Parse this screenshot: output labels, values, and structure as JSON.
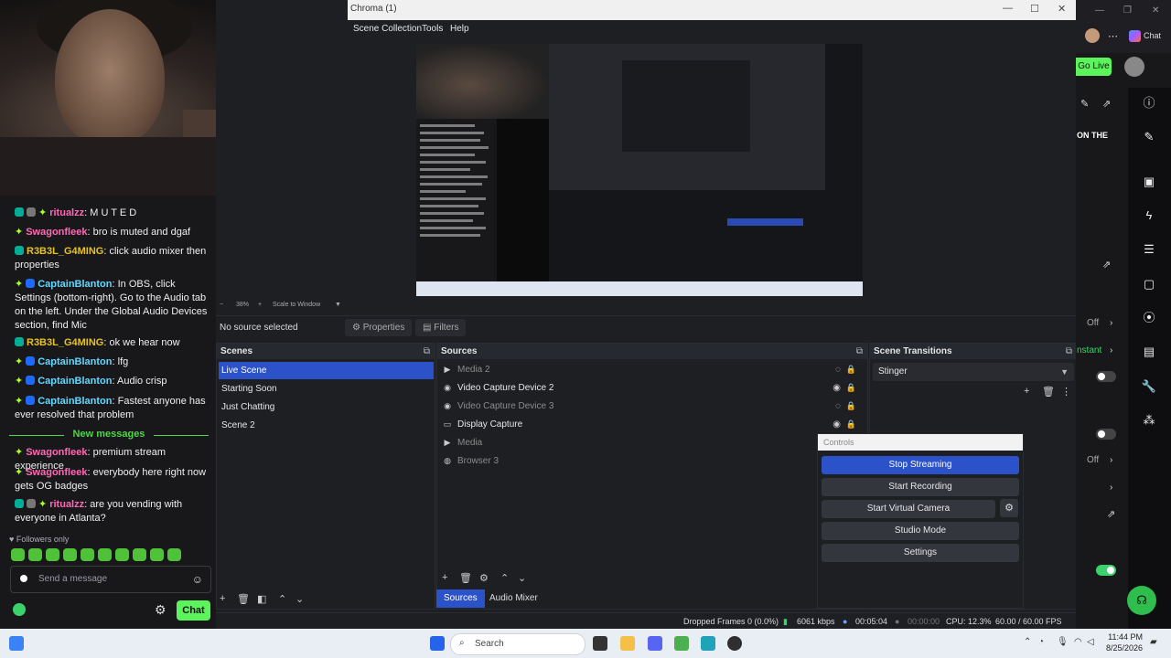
{
  "obs": {
    "window_title": "Chroma (1)",
    "menu": [
      "Scene Collection",
      "Tools",
      "Help"
    ],
    "zoom": [
      "38%",
      "Scale to Window"
    ],
    "no_source": "No source selected",
    "properties_label": "Properties",
    "filters_label": "Filters",
    "scenes": {
      "title": "Scenes",
      "items": [
        "Live Scene",
        "Starting Soon",
        "Just Chatting",
        "Scene 2"
      ]
    },
    "sources": {
      "title": "Sources",
      "items": [
        "Media 2",
        "Video Capture Device 2",
        "Video Capture Device 3",
        "Display Capture",
        "Media",
        "Browser 3"
      ]
    },
    "transitions": {
      "title": "Scene Transitions",
      "selected": "Stinger"
    },
    "controls": {
      "title": "Controls",
      "buttons": [
        "Stop Streaming",
        "Start Recording",
        "Start Virtual Camera",
        "Studio Mode",
        "Settings"
      ]
    },
    "tabs": [
      "Sources",
      "Audio Mixer"
    ],
    "status": {
      "dropped": "Dropped Frames 0 (0.0%)",
      "bitrate": "6061 kbps",
      "stream_time": "00:05:04",
      "rec_time": "00:00:00",
      "cpu": "CPU: 12.3%",
      "fps": "60.00 / 60.00 FPS"
    }
  },
  "chat": {
    "messages": [
      {
        "user": "ritualzz",
        "sep": ": ",
        "text": "M U T E D"
      },
      {
        "user": "Swagonfleek",
        "sep": ": ",
        "text": "bro is muted and dgaf"
      },
      {
        "user": "R3B3L_G4MING",
        "sep": ": ",
        "text": "click audio mixer then properties"
      },
      {
        "user": "CaptainBlanton",
        "sep": ": ",
        "text": "In OBS, click Settings (bottom-right). Go to the Audio tab on the left. Under the Global Audio Devices section, find Mic"
      },
      {
        "user": "R3B3L_G4MING",
        "sep": ": ",
        "text": "ok we hear now"
      },
      {
        "user": "CaptainBlanton",
        "sep": ": ",
        "text": "lfg"
      },
      {
        "user": "CaptainBlanton",
        "sep": ": ",
        "text": "Audio crisp"
      },
      {
        "user": "CaptainBlanton",
        "sep": ": ",
        "text": "Fastest anyone has ever resolved that problem"
      },
      {
        "user": "Swagonfleek",
        "sep": ": ",
        "text": "premium stream experience"
      },
      {
        "user": "Swagonfleek",
        "sep": ": ",
        "text": "everybody here right now gets OG badges"
      },
      {
        "user": "ritualzz",
        "sep": ": ",
        "text": "are you vending with everyone in Atlanta?"
      }
    ],
    "new_messages": "New messages",
    "followers_only": "Followers only",
    "placeholder": "Send a message",
    "send_label": "Chat"
  },
  "twitch": {
    "chat_label": "Chat",
    "go_live": "Go Live",
    "on_the": "ON THE",
    "off1": "Off",
    "instant": "nstant",
    "off2": "Off"
  },
  "taskbar": {
    "search": "Search",
    "time": "11:44 PM",
    "date": "8/25/2026"
  },
  "colors": {
    "accent_blue": "#2b52c9",
    "twitch_green": "#5bf55b"
  }
}
